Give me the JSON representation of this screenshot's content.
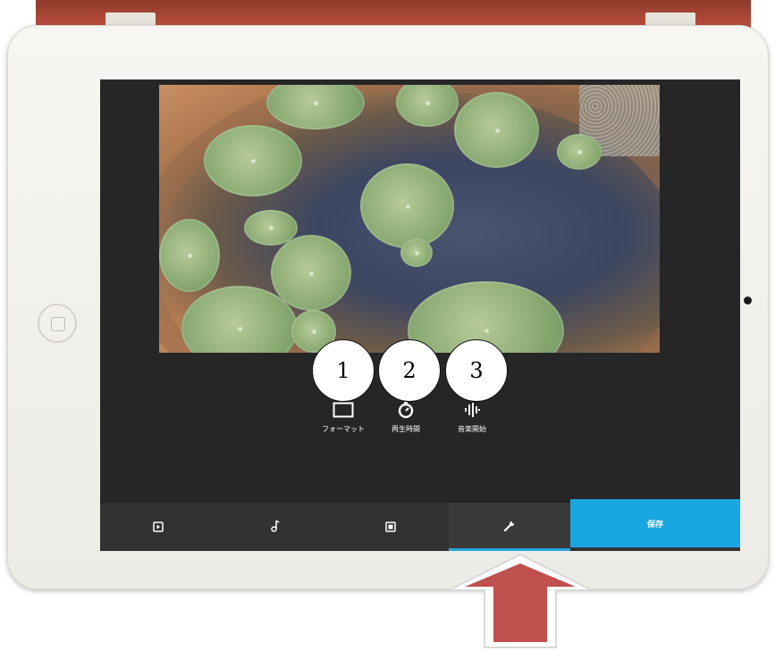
{
  "tools": [
    {
      "label": "フォーマット",
      "icon": "rectangle-format-icon"
    },
    {
      "label": "再生時間",
      "icon": "timer-icon"
    },
    {
      "label": "音楽開始",
      "icon": "audio-waveform-icon"
    }
  ],
  "callouts": [
    "1",
    "2",
    "3"
  ],
  "tabs": [
    {
      "icon": "media-clip-icon"
    },
    {
      "icon": "music-note-icon"
    },
    {
      "icon": "media-alt-icon"
    },
    {
      "icon": "wrench-icon",
      "active": true
    }
  ],
  "save_label": "保存",
  "colors": {
    "accent": "#19a6e0",
    "panel": "#262626",
    "tabbar": "#323232",
    "arrow": "#c0504d"
  }
}
